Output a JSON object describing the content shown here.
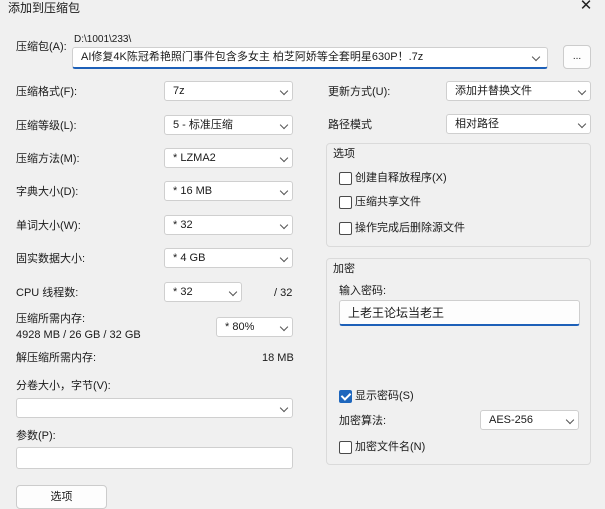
{
  "window": {
    "title": "添加到压缩包"
  },
  "archive": {
    "label": "压缩包(A):",
    "dir": "D:\\1001\\233\\",
    "filename": "AI修复4K陈冠希艳照门事件包含多女主 柏芝阿娇等全套明星630P！.7z",
    "browse": "..."
  },
  "left": {
    "format": {
      "label": "压缩格式(F):",
      "value": "7z"
    },
    "level": {
      "label": "压缩等级(L):",
      "value": "5 - 标准压缩"
    },
    "method": {
      "label": "压缩方法(M):",
      "value": "* LZMA2"
    },
    "dict": {
      "label": "字典大小(D):",
      "value": "* 16 MB"
    },
    "word": {
      "label": "单词大小(W):",
      "value": "* 32"
    },
    "solid": {
      "label": "固实数据大小:",
      "value": "* 4 GB"
    },
    "threads": {
      "label": "CPU 线程数:",
      "value": "* 32",
      "max": "/ 32"
    },
    "memory": {
      "label": "压缩所需内存:",
      "detail": "4928 MB / 26 GB / 32 GB",
      "value": "* 80%"
    },
    "decomp": {
      "label": "解压缩所需内存:",
      "value": "18 MB"
    },
    "split": {
      "label": "分卷大小，字节(V):",
      "value": ""
    },
    "params": {
      "label": "参数(P):",
      "value": ""
    },
    "options_button": "选项"
  },
  "right": {
    "update": {
      "label": "更新方式(U):",
      "value": "添加并替换文件"
    },
    "pathmode": {
      "label": "路径模式",
      "value": "相对路径"
    },
    "options": {
      "title": "选项",
      "sfx": "创建自释放程序(X)",
      "shared": "压缩共享文件",
      "delete": "操作完成后删除源文件"
    },
    "encrypt": {
      "title": "加密",
      "pw_label": "输入密码:",
      "password": "上老王论坛当老王",
      "show": "显示密码(S)",
      "method_label": "加密算法:",
      "method": "AES-256",
      "encrypt_names": "加密文件名(N)"
    }
  }
}
